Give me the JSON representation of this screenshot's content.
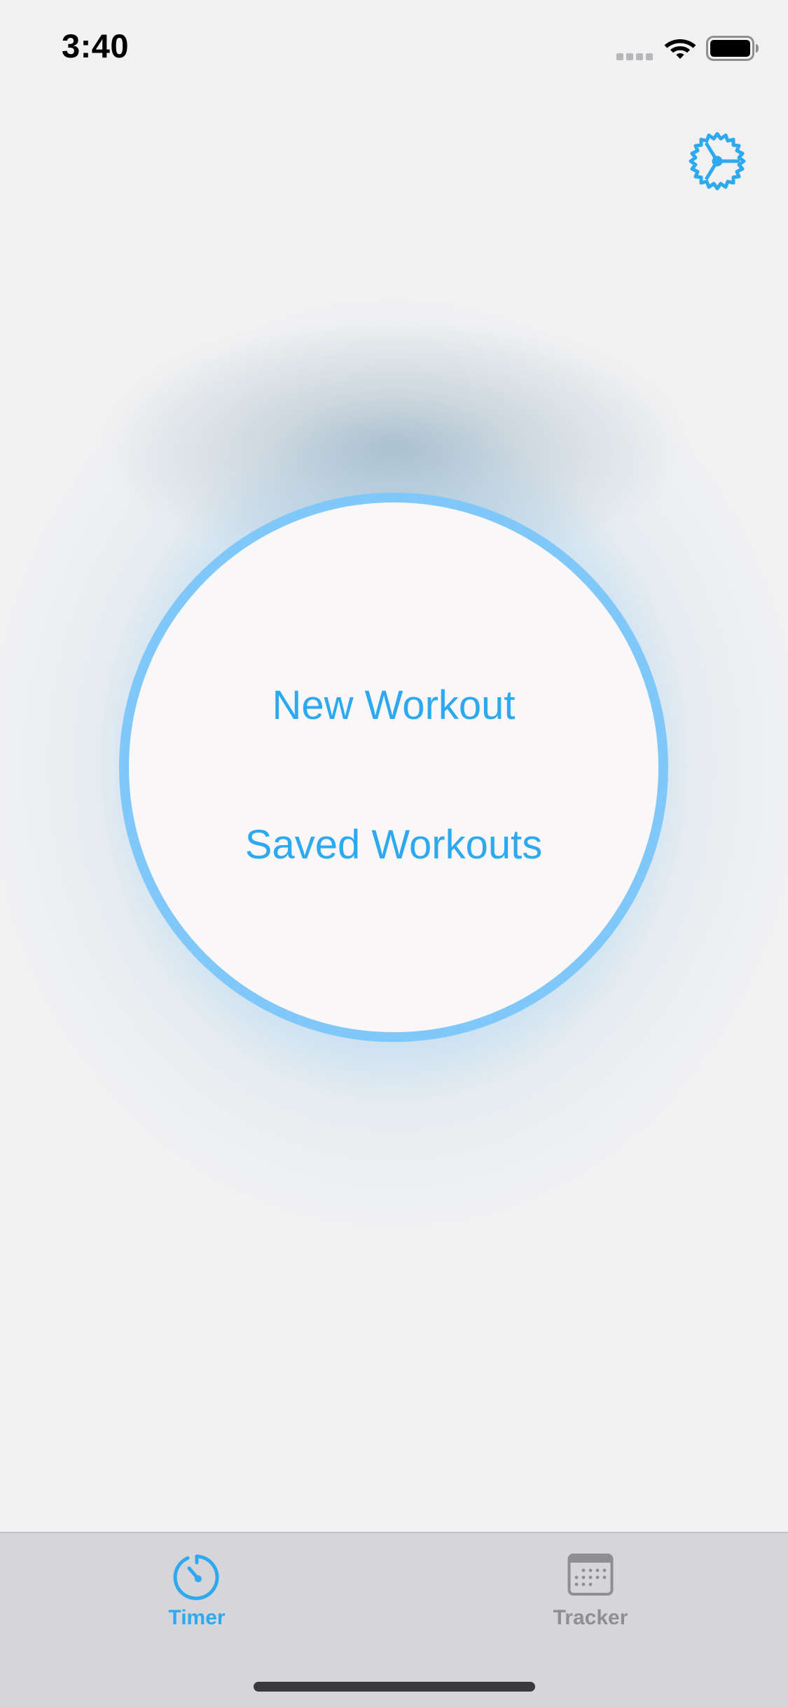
{
  "status_bar": {
    "time": "3:40"
  },
  "settings": {
    "icon": "gear-icon"
  },
  "menu": {
    "new_workout_label": "New Workout",
    "saved_workouts_label": "Saved Workouts"
  },
  "tab_bar": {
    "tabs": [
      {
        "label": "Timer",
        "icon": "timer-icon",
        "selected": true
      },
      {
        "label": "Tracker",
        "icon": "calendar-icon",
        "selected": false
      }
    ]
  },
  "colors": {
    "accent": "#2ea9ef",
    "circle_border": "#80c8fa",
    "glow": "#76c4f8",
    "background": "#f1f1f2",
    "tab_bar_background": "#d6d6da",
    "inactive_tab": "#8e8e93"
  }
}
